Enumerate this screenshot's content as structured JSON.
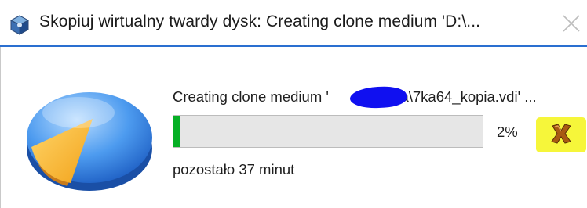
{
  "window": {
    "title": "Skopiuj wirtualny twardy dysk: Creating clone medium 'D:\\..."
  },
  "icons": {
    "app": "virtualbox-cube-icon",
    "progress": "pie-progress-icon",
    "cancel": "cancel-x-icon",
    "close": "close-icon"
  },
  "progress": {
    "status_prefix": "Creating clone medium '",
    "status_visible_rest": "7ka\\7ka64_kopia.vdi' ...",
    "percent_text": "2%",
    "fraction": 0.02,
    "remaining": "pozostało 37 minut"
  },
  "colors": {
    "progress_fill": "#06b025",
    "redaction": "#1010f0",
    "highlight": "#f6f63a",
    "title_border": "#2a6fd0"
  }
}
